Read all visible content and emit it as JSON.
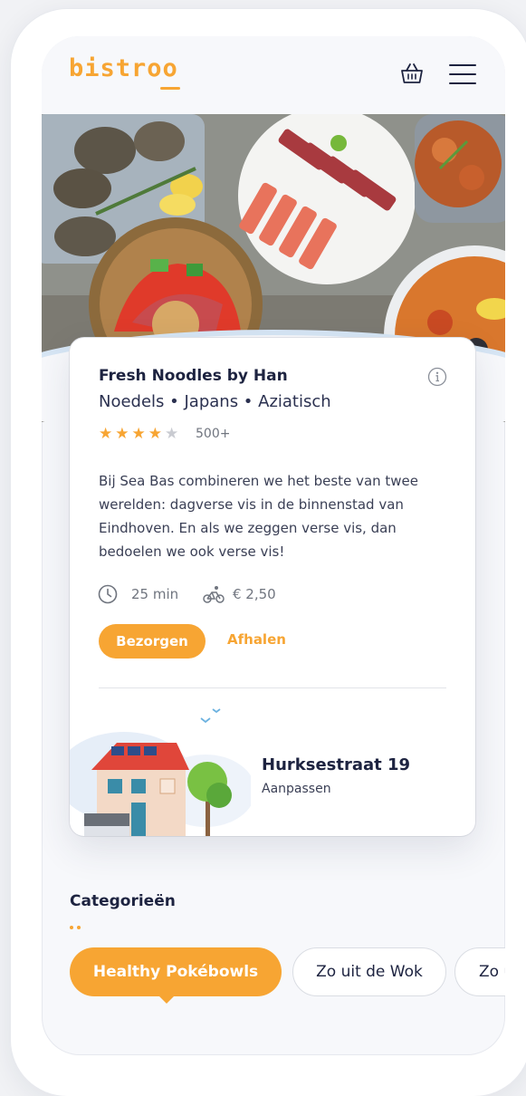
{
  "header": {
    "logo": "bistroo",
    "basket_icon": "basket-icon",
    "menu_icon": "hamburger-menu-icon"
  },
  "restaurant": {
    "name": "Fresh Noodles by Han",
    "cuisine": "Noedels • Japans • Aziatisch",
    "rating": 4,
    "rating_max": 5,
    "reviews": "500+",
    "description": "Bij Sea Bas combineren we het beste van twee werelden: dagverse vis in de binnenstad van Eindhoven. En als we zeggen verse vis, dan bedoelen we ook verse vis!",
    "delivery_time": "25 min",
    "delivery_fee": "€ 2,50",
    "deliver_label": "Bezorgen",
    "pickup_label": "Afhalen"
  },
  "address": {
    "street": "Hurksestraat 19",
    "edit_label": "Aanpassen"
  },
  "categories": {
    "title": "Categorieën",
    "items": [
      {
        "label": "Healthy Pokébowls",
        "active": true
      },
      {
        "label": "Zo uit de Wok",
        "active": false
      },
      {
        "label": "Zo uit de Wok",
        "active": false
      }
    ]
  },
  "colors": {
    "brand": "#f7a533",
    "text_dark": "#1d2340",
    "text_muted": "#70757f"
  }
}
